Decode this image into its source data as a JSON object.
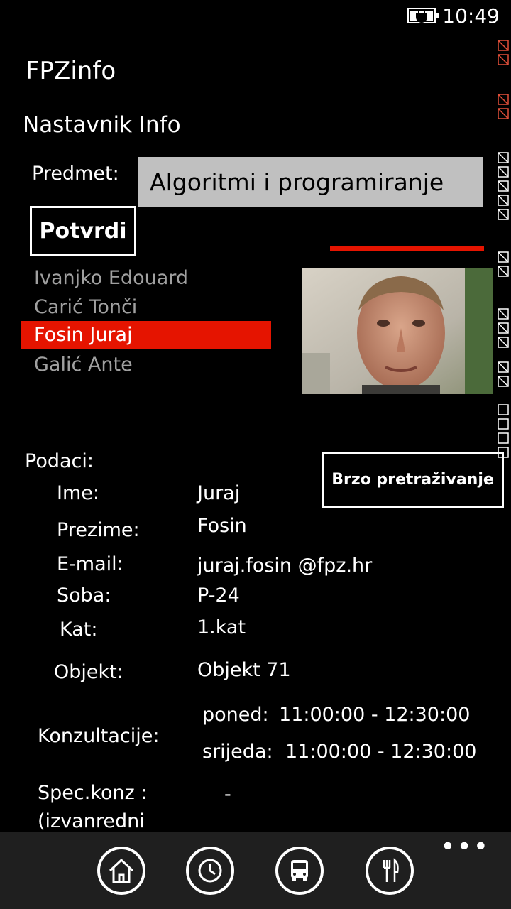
{
  "status": {
    "time": "10:49"
  },
  "app": {
    "title": "FPZinfo",
    "page_title": "Nastavnik Info"
  },
  "subject": {
    "label": "Predmet:",
    "value": "Algoritmi i programiranje"
  },
  "buttons": {
    "confirm": "Potvrdi",
    "quick_search": "Brzo pretraživanje"
  },
  "teachers": [
    {
      "name": "Ivanjko Edouard",
      "selected": false
    },
    {
      "name": "Carić Tonči",
      "selected": false
    },
    {
      "name": "Fosin Juraj",
      "selected": true
    },
    {
      "name": "Galić Ante",
      "selected": false
    }
  ],
  "details": {
    "heading": "Podaci:",
    "ime_label": "Ime:",
    "ime": "Juraj",
    "prezime_label": "Prezime:",
    "prezime": "Fosin",
    "email_label": "E-mail:",
    "email": "juraj.fosin @fpz.hr",
    "soba_label": "Soba:",
    "soba": "P-24",
    "kat_label": "Kat:",
    "kat": "1.kat",
    "objekt_label": "Objekt:",
    "objekt": "Objekt 71",
    "konz_label": "Konzultacije:",
    "konz_1_day": "poned:",
    "konz_1_time": "11:00:00 - 12:30:00",
    "konz_2_day": "srijeda:",
    "konz_2_time": "11:00:00 - 12:30:00",
    "spec_label_1": "Spec.konz :",
    "spec_label_2": "(izvanredni",
    "spec_value": "-"
  },
  "appbar": {
    "icons": [
      "home-icon",
      "clock-icon",
      "bus-icon",
      "restaurant-icon"
    ],
    "more": "•••"
  },
  "colors": {
    "accent": "#e51400",
    "background": "#000000",
    "field": "#c0c0c0"
  }
}
